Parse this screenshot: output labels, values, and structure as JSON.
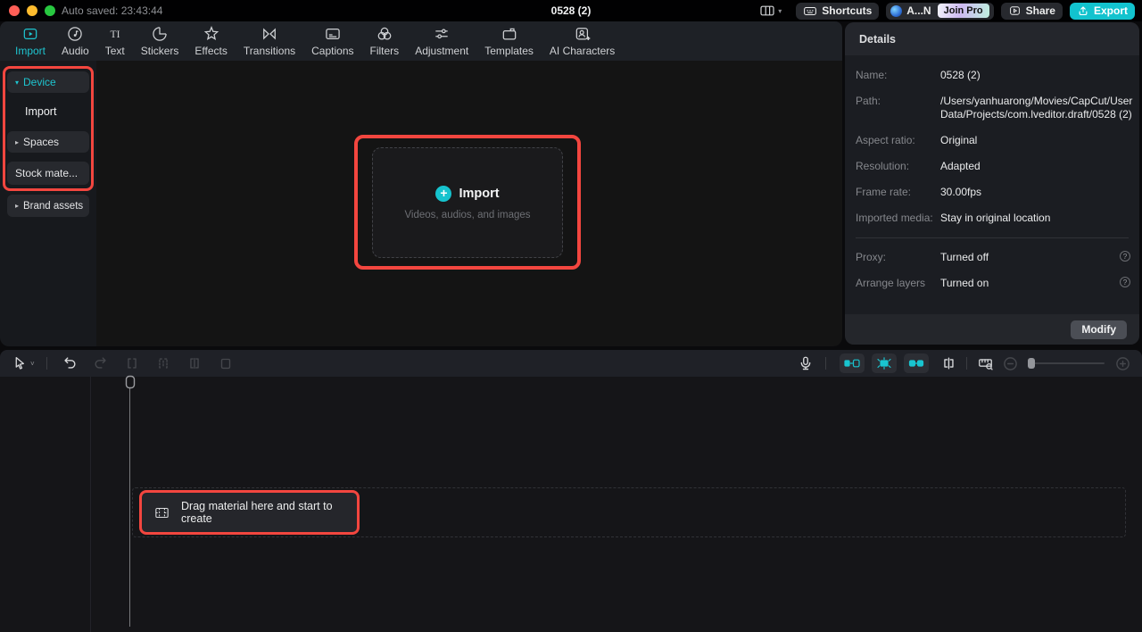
{
  "titlebar": {
    "autosave": "Auto saved: 23:43:44",
    "title": "0528 (2)",
    "shortcuts": "Shortcuts",
    "account": "A...N",
    "join_pro": "Join Pro",
    "share": "Share",
    "export": "Export"
  },
  "tabs": [
    {
      "label": "Import",
      "active": true
    },
    {
      "label": "Audio"
    },
    {
      "label": "Text"
    },
    {
      "label": "Stickers"
    },
    {
      "label": "Effects"
    },
    {
      "label": "Transitions"
    },
    {
      "label": "Captions"
    },
    {
      "label": "Filters"
    },
    {
      "label": "Adjustment"
    },
    {
      "label": "Templates"
    },
    {
      "label": "AI Characters"
    }
  ],
  "sidebar": {
    "device": "Device",
    "import": "Import",
    "spaces": "Spaces",
    "stock": "Stock mate...",
    "brand": "Brand assets"
  },
  "media": {
    "import_title": "Import",
    "import_subtitle": "Videos, audios, and images"
  },
  "details": {
    "header": "Details",
    "rows": {
      "name": {
        "label": "Name:",
        "value": "0528 (2)"
      },
      "path": {
        "label": "Path:",
        "value": "/Users/yanhuarong/Movies/CapCut/User Data/Projects/com.lveditor.draft/0528 (2)"
      },
      "aspect": {
        "label": "Aspect ratio:",
        "value": "Original"
      },
      "resolution": {
        "label": "Resolution:",
        "value": "Adapted"
      },
      "framerate": {
        "label": "Frame rate:",
        "value": "30.00fps"
      },
      "imported": {
        "label": "Imported media:",
        "value": "Stay in original location"
      },
      "proxy": {
        "label": "Proxy:",
        "value": "Turned off"
      },
      "arrange": {
        "label": "Arrange layers",
        "value": "Turned on"
      }
    },
    "modify": "Modify"
  },
  "timeline": {
    "drag_hint": "Drag material here and start to create"
  },
  "colors": {
    "accent": "#16c3ce",
    "highlight": "#f3463f"
  }
}
